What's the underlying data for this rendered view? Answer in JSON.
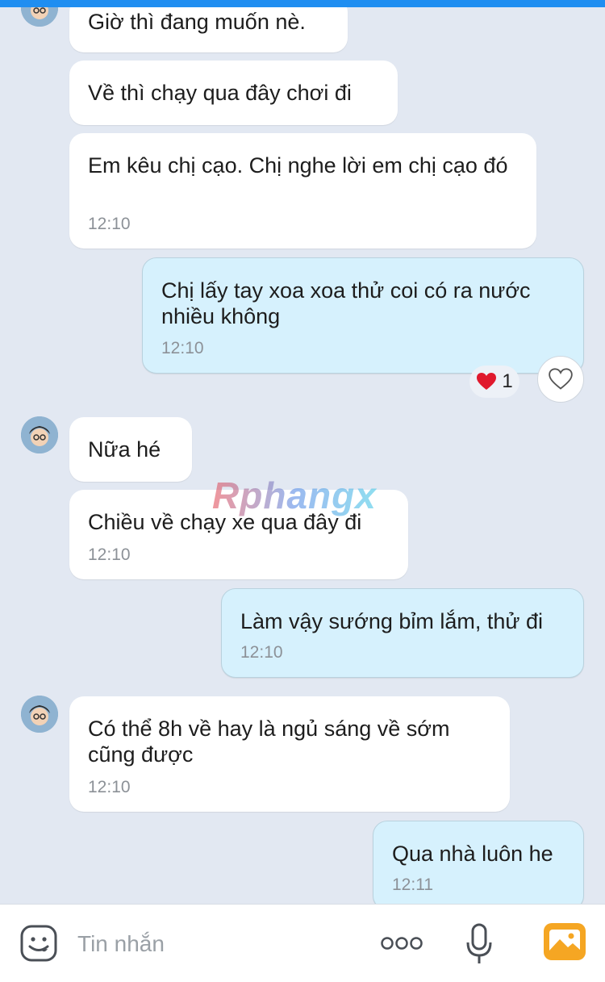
{
  "messages": [
    {
      "side": "in",
      "text": "Giờ thì đang muốn nè.",
      "time": ""
    },
    {
      "side": "in",
      "text": "Về thì chạy qua đây chơi đi",
      "time": ""
    },
    {
      "side": "in",
      "text": "Em kêu chị cạo.  Chị nghe lời em chị cạo đó",
      "time": "12:10"
    },
    {
      "side": "out",
      "text": "Chị lấy tay xoa xoa thử coi có ra nước nhiều không",
      "time": "12:10",
      "reaction_count": "1"
    },
    {
      "side": "in",
      "text": "Nữa hé",
      "time": ""
    },
    {
      "side": "in",
      "text": "Chiều về chạy xe qua đây đi",
      "time": "12:10"
    },
    {
      "side": "out",
      "text": "Làm vậy sướng bỉm lắm, thử đi",
      "time": "12:10"
    },
    {
      "side": "in",
      "text": "Có thể 8h về  hay là ngủ sáng về sớm cũng được",
      "time": "12:10"
    },
    {
      "side": "out",
      "text": "Qua nhà luôn he",
      "time": "12:11"
    }
  ],
  "watermark": "Rphangx",
  "composer": {
    "placeholder": "Tin nhắn",
    "icons": [
      "sticker-icon",
      "more-icon",
      "microphone-icon",
      "image-icon"
    ]
  },
  "colors": {
    "background": "#e2e8f2",
    "incoming_bubble": "#ffffff",
    "outgoing_bubble": "#d6f1fd",
    "accent": "#1f8ef1",
    "image_button": "#f5a623"
  }
}
